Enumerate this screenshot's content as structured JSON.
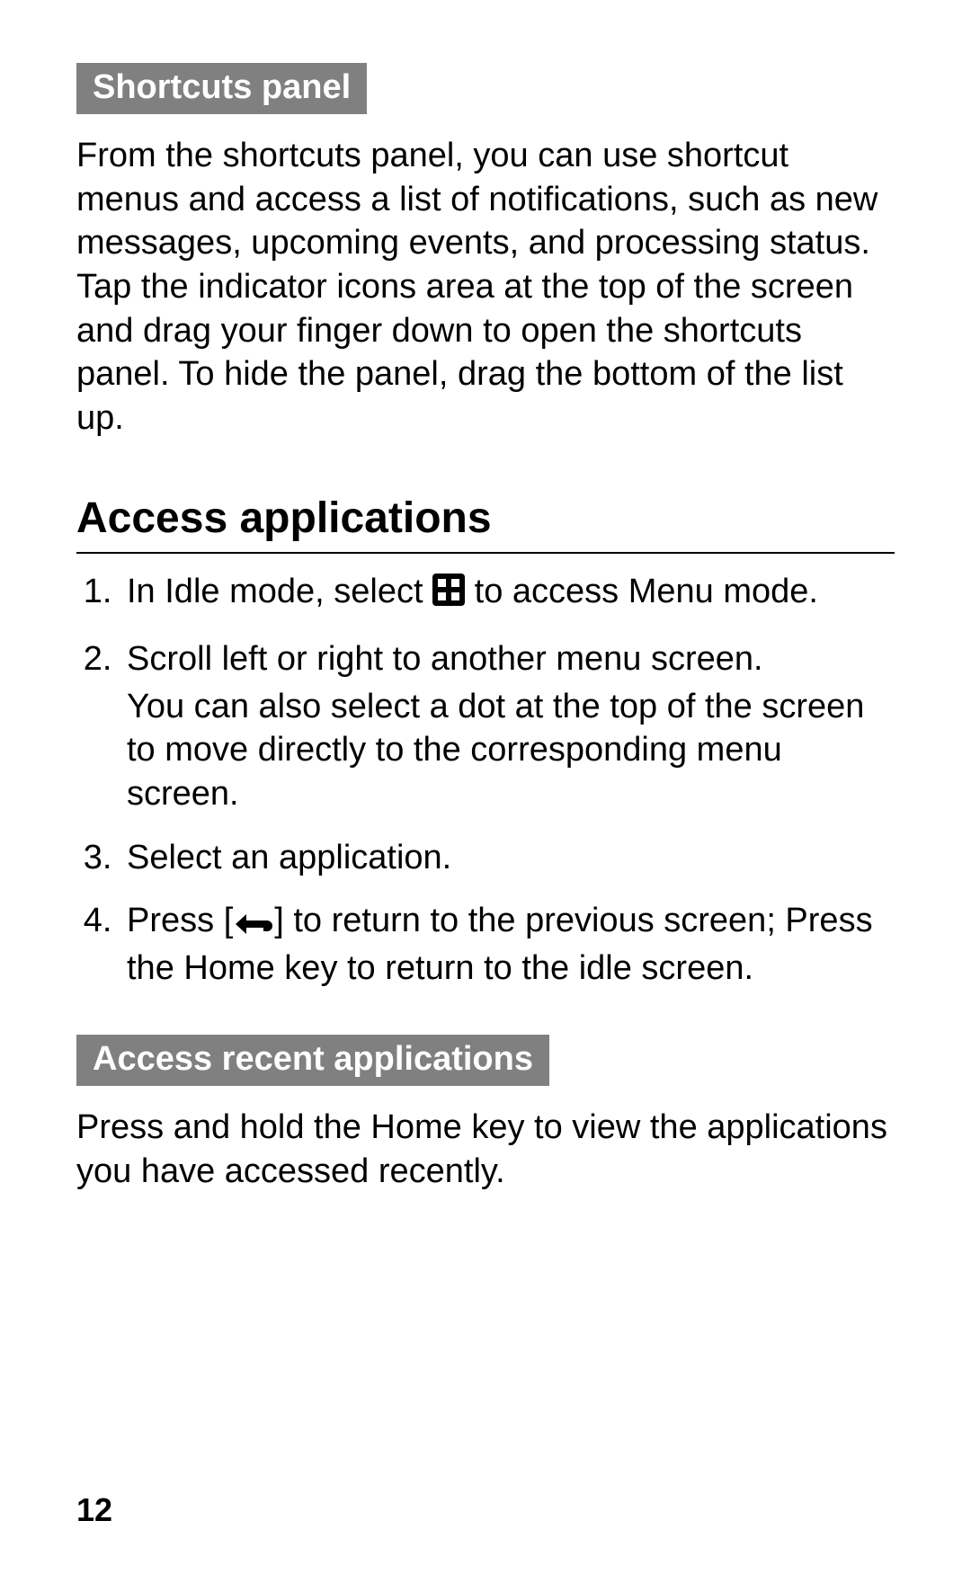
{
  "sections": {
    "shortcuts": {
      "heading": "Shortcuts panel",
      "body": "From the shortcuts panel, you can use shortcut menus and access a list of notifications, such as new messages, upcoming events, and processing status. Tap the indicator icons area at the top of the screen and drag your finger down to open the shortcuts panel. To hide the panel, drag the bottom of the list up."
    },
    "access_apps": {
      "title": "Access applications",
      "steps": {
        "s1_pre": "In Idle mode, select ",
        "s1_post": " to access Menu mode.",
        "s2_main": "Scroll left or right to another menu screen.",
        "s2_sub": "You can also select a dot at the top of the screen to move directly to the corresponding menu screen.",
        "s3": "Select an application.",
        "s4_pre": "Press [",
        "s4_post": "] to return to the previous screen; Press the Home key to return to the idle screen."
      }
    },
    "recent_apps": {
      "heading": "Access recent applications",
      "body": "Press and hold the Home key to view the applications you have accessed recently."
    }
  },
  "icons": {
    "menu_grid": "menu-grid-icon",
    "back_arrow": "back-arrow-icon"
  },
  "page_number": "12"
}
